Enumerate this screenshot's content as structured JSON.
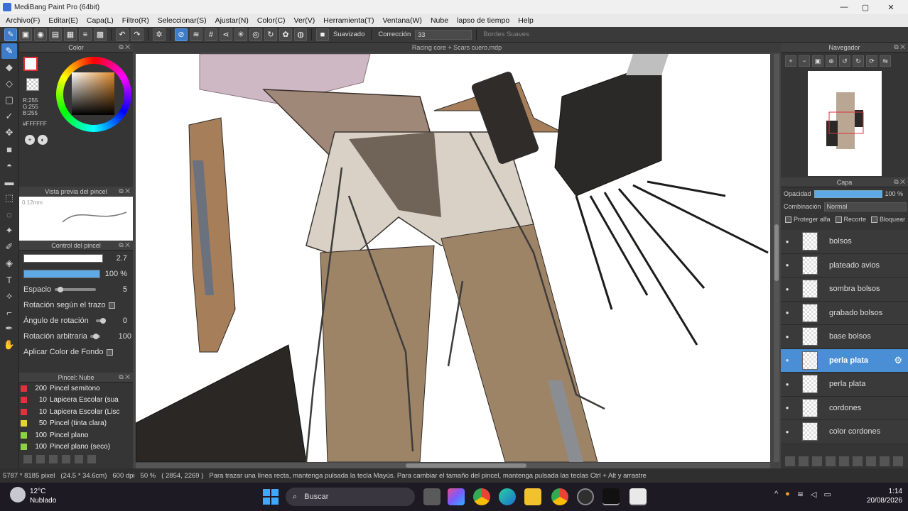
{
  "window": {
    "title": "MediBang Paint Pro (64bit)",
    "minimize": "—",
    "maximize": "▢",
    "close": "✕"
  },
  "menu": [
    "Archivo(F)",
    "Editar(E)",
    "Capa(L)",
    "Filtro(R)",
    "Seleccionar(S)",
    "Ajustar(N)",
    "Color(C)",
    "Ver(V)",
    "Herramienta(T)",
    "Ventana(W)",
    "Nube",
    "lapso de tiempo",
    "Help"
  ],
  "toolbar": {
    "smooth_label": "Suavizado",
    "correction_label": "Corrección",
    "correction_value": "33",
    "soft_edges_label": "Bordes Suaves"
  },
  "color_panel": {
    "title": "Color",
    "r": "R:255",
    "g": "G:255",
    "b": "B:255",
    "hex": "#FFFFFF"
  },
  "brush_preview": {
    "title": "Vista previa del pincel",
    "size": "0.12mm"
  },
  "brush_control": {
    "title": "Control del pincel",
    "size_value": "2.7",
    "opacity_value": "100 %",
    "rows": [
      {
        "label": "Espacio",
        "value": "5"
      },
      {
        "label": "Rotación según el trazo",
        "value": ""
      },
      {
        "label": "Ángulo de rotación",
        "value": "0"
      },
      {
        "label": "Rotación arbitraria",
        "value": "100"
      },
      {
        "label": "Aplicar Color de Fondo",
        "value": ""
      }
    ]
  },
  "brush_list": {
    "title": "Pincel: Nube",
    "items": [
      {
        "size": "200",
        "name": "Pincel semitono",
        "color": "#e0323c"
      },
      {
        "size": "10",
        "name": "Lapicera Escolar (sua",
        "color": "#e0323c"
      },
      {
        "size": "10",
        "name": "Lapicera Escolar (Lisc",
        "color": "#e0323c"
      },
      {
        "size": "50",
        "name": "Pincel (tinta clara)",
        "color": "#e6d23a"
      },
      {
        "size": "100",
        "name": "Pincel plano",
        "color": "#8fd04a"
      },
      {
        "size": "100",
        "name": "Pincel plano (seco)",
        "color": "#8fd04a"
      }
    ]
  },
  "document": {
    "tab": "Racing core + Scars cuero.mdp"
  },
  "navigator": {
    "title": "Navegador"
  },
  "layers": {
    "title": "Capa",
    "opacity_label": "Opacidad",
    "opacity_value": "100 %",
    "blend_label": "Combinación",
    "blend_value": "Normal",
    "protect_alpha": "Proteger alfa",
    "clip": "Recorte",
    "lock": "Bloquear",
    "items": [
      {
        "name": "bolsos",
        "selected": false
      },
      {
        "name": "plateado avios",
        "selected": false
      },
      {
        "name": "sombra bolsos",
        "selected": false
      },
      {
        "name": "grabado bolsos",
        "selected": false
      },
      {
        "name": "base bolsos",
        "selected": false
      },
      {
        "name": "perla plata",
        "selected": true
      },
      {
        "name": "perla plata",
        "selected": false
      },
      {
        "name": "cordones",
        "selected": false
      },
      {
        "name": "color cordones",
        "selected": false
      }
    ]
  },
  "status": {
    "dimensions": "5787 * 8185 pixel",
    "physical": "(24.5 * 34.6cm)",
    "dpi": "600 dpi",
    "zoom": "50 %",
    "coords": "( 2854, 2269 )",
    "hint": "Para trazar una línea recta, mantenga pulsada la tecla Mayús. Para cambiar el tamaño del pincel, mantenga pulsada las teclas Ctrl + Alt y arrastre"
  },
  "taskbar": {
    "temp": "12°C",
    "weather": "Nublado",
    "search_placeholder": "Buscar",
    "time": "1:14",
    "date": "20/08/2026"
  }
}
